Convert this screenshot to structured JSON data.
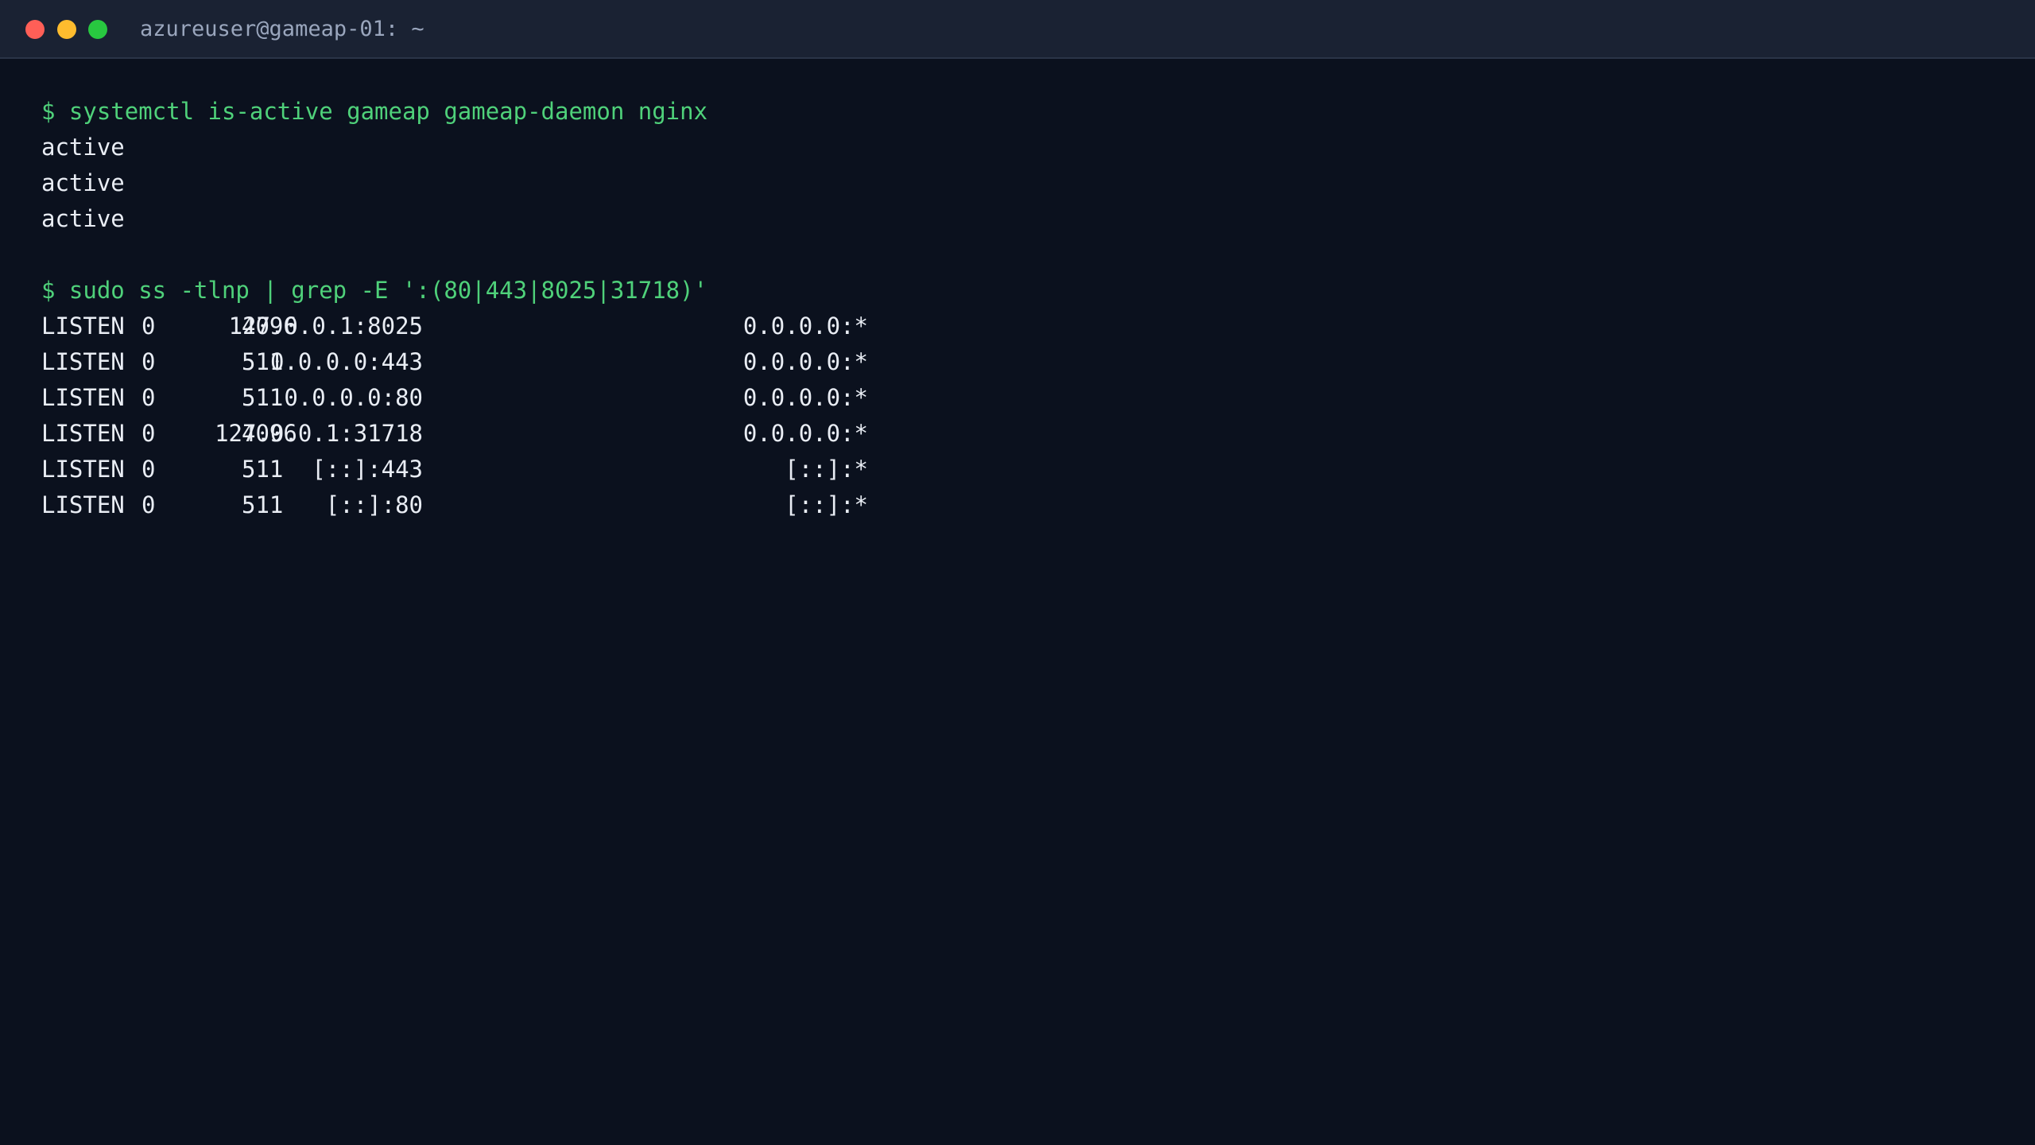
{
  "window": {
    "title": "azureuser@gameap-01: ~",
    "controls": {
      "close_color": "#ff5f57",
      "minimize_color": "#febc2e",
      "maximize_color": "#28c840"
    }
  },
  "colors": {
    "background": "#0b111e",
    "titlebar": "#1a2233",
    "command": "#4fd17a",
    "output": "#e9edf4"
  },
  "session": {
    "commands": [
      {
        "prompt_line": "$ systemctl is-active gameap gameap-daemon nginx",
        "output": [
          "active",
          "active",
          "active"
        ]
      },
      {
        "prompt_line": "$ sudo ss -tlnp | grep -E ':(80|443|8025|31718)'",
        "rows": [
          {
            "state": "LISTEN",
            "recvq": "0",
            "sendq": "4096",
            "local": "127.0.0.1:8025",
            "peer": "0.0.0.0:*"
          },
          {
            "state": "LISTEN",
            "recvq": "0",
            "sendq": "511",
            "local": "0.0.0.0:443",
            "peer": "0.0.0.0:*"
          },
          {
            "state": "LISTEN",
            "recvq": "0",
            "sendq": "511",
            "local": "0.0.0.0:80",
            "peer": "0.0.0.0:*"
          },
          {
            "state": "LISTEN",
            "recvq": "0",
            "sendq": "4096",
            "local": "127.0.0.1:31718",
            "peer": "0.0.0.0:*"
          },
          {
            "state": "LISTEN",
            "recvq": "0",
            "sendq": "511",
            "local": "[::]:443",
            "peer": "[::]:*"
          },
          {
            "state": "LISTEN",
            "recvq": "0",
            "sendq": "511",
            "local": "[::]:80",
            "peer": "[::]:*"
          }
        ]
      }
    ]
  }
}
